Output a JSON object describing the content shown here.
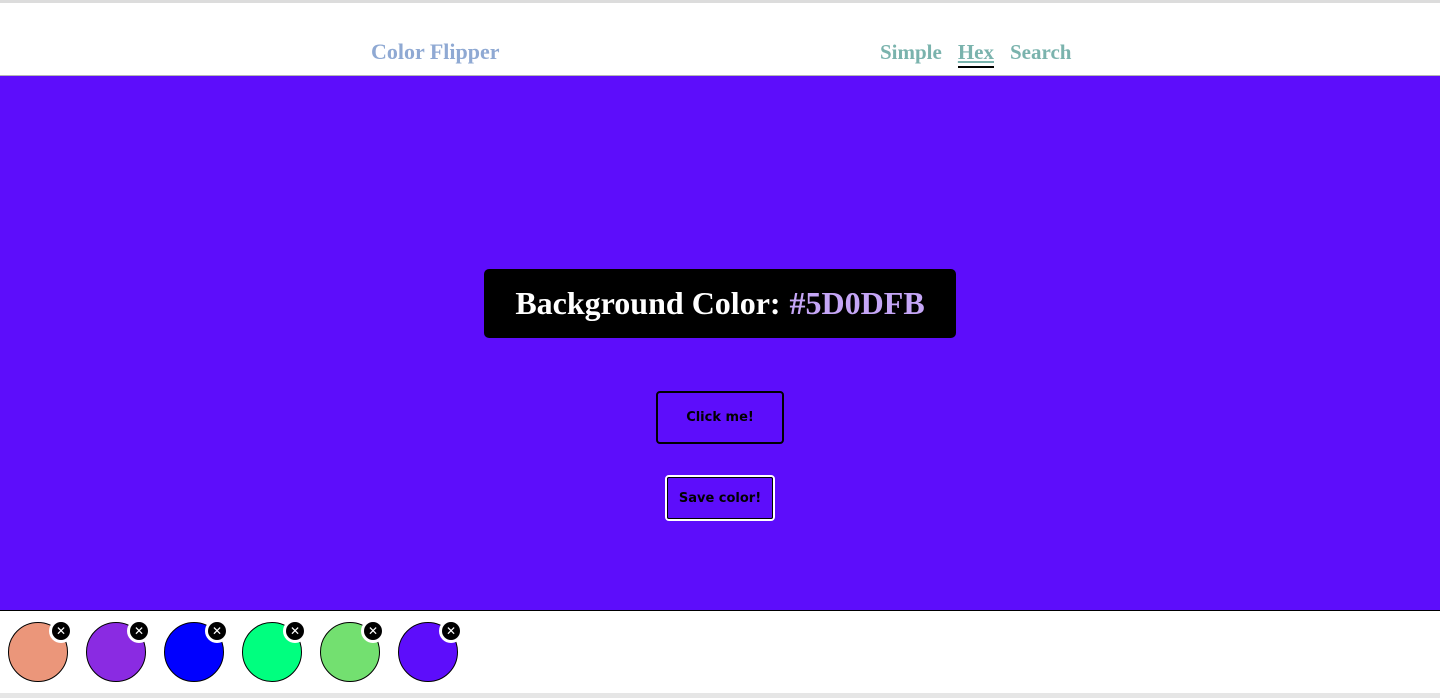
{
  "colors": {
    "background": "#5D0DFB",
    "hex_text": "#C5A6F6",
    "brand": "#8FA9D3",
    "nav_link": "#7AB3AD"
  },
  "header": {
    "brand": "Color Flipper",
    "nav": [
      {
        "label": "Simple",
        "active": false
      },
      {
        "label": "Hex",
        "active": true
      },
      {
        "label": "Search",
        "active": false
      }
    ]
  },
  "main": {
    "label": "Background Color:",
    "hex": "#5D0DFB",
    "click_label": "Click me!",
    "save_label": "Save color!"
  },
  "palette": {
    "remove_icon": "close-circle-icon",
    "swatches": [
      {
        "color": "#EB967A"
      },
      {
        "color": "#8A2BE2"
      },
      {
        "color": "#0000FF"
      },
      {
        "color": "#00FF7F"
      },
      {
        "color": "#73E070"
      },
      {
        "color": "#5D0DFB"
      }
    ]
  }
}
